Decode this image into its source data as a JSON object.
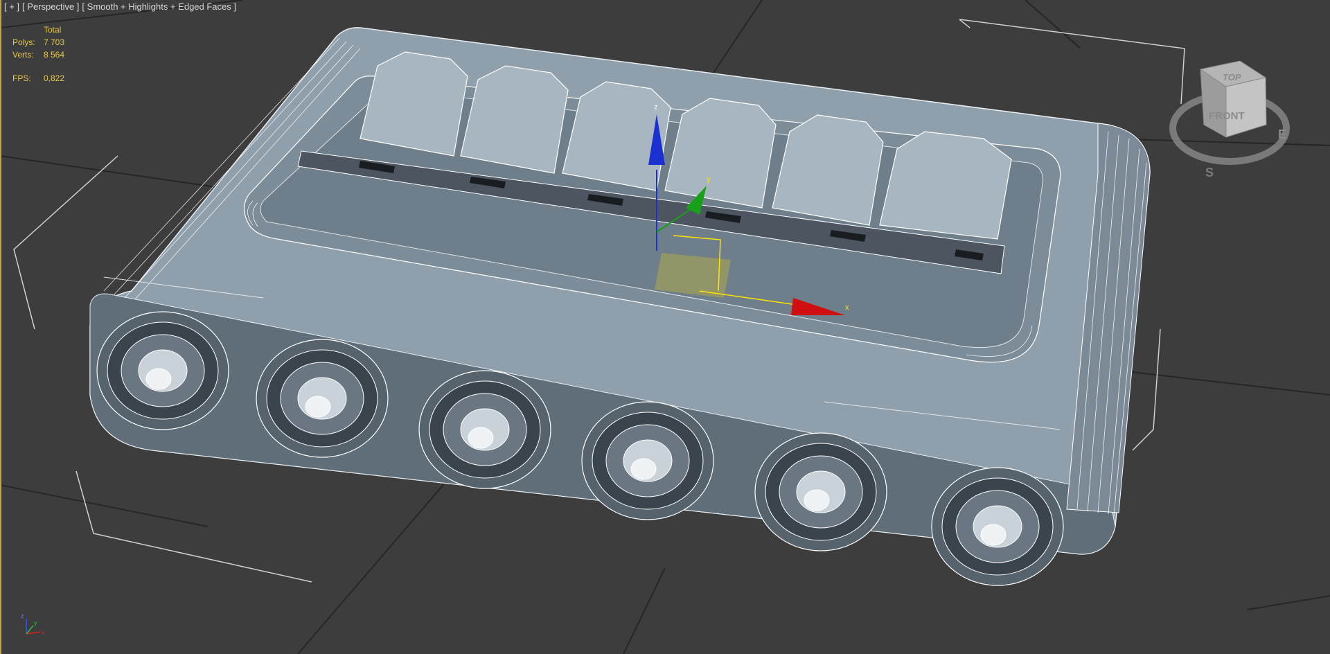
{
  "viewport": {
    "label_parts": [
      "[ + ]",
      "[ Perspective ]",
      "[ Smooth + Highlights + Edged Faces ]"
    ],
    "stats": {
      "header": "Total",
      "polys_label": "Polys:",
      "polys_value": "7 703",
      "verts_label": "Verts:",
      "verts_value": "8 564",
      "fps_label": "FPS:",
      "fps_value": "0,822"
    },
    "viewcube": {
      "top_label": "TOP",
      "front_label": "FRONT",
      "compass_e": "E",
      "compass_s": "S"
    },
    "gizmo": {
      "x_label": "x",
      "y_label": "y",
      "z_label": "z"
    },
    "axis_tripod": {
      "x_label": "x",
      "y_label": "y",
      "z_label": "z"
    }
  },
  "colors": {
    "background": "#3d3d3d",
    "model": "#8a9aa6",
    "wire": "#ffffff",
    "x_axis": "#d01010",
    "y_axis": "#18a018",
    "z_axis": "#1a30d0",
    "stats_text": "#e6c84a"
  }
}
